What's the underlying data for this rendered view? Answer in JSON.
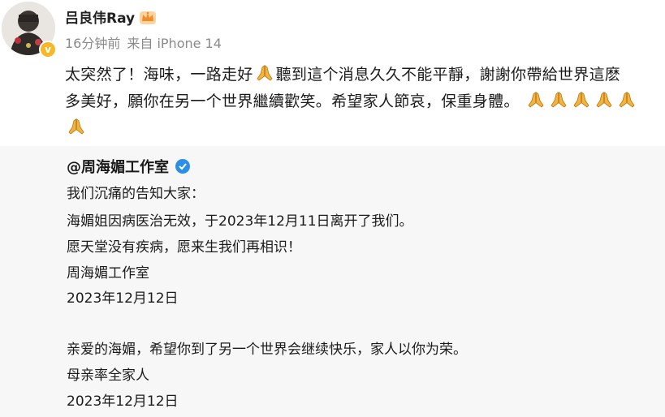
{
  "post": {
    "username": "吕良伟Ray",
    "time": "16分钟前",
    "source": "来自 iPhone 14",
    "text_line1_a": "太突然了！海味，一路走好",
    "text_line1_b": "聽到這个消息久久不能平靜，謝謝你帶給世界這麽",
    "text_line2": "多美好，願你在另一个世界繼續歡笑。希望家人節哀，保重身體。"
  },
  "repost": {
    "author": "@周海媚工作室",
    "lines": [
      "我们沉痛的告知大家：",
      "海媚姐因病医治无效，于2023年12月11日离开了我们。",
      "愿天堂没有疾病，愿来生我们再相识！",
      "周海媚工作室",
      "2023年12月12日",
      "亲爱的海媚，希望你到了另一个世界会继续快乐，家人以你为荣。",
      "母亲率全家人",
      "2023年12月12日"
    ]
  },
  "icons": {
    "verified_gold": "gold-v-badge-icon",
    "verified_blue": "blue-v-badge-icon",
    "crown": "crown-icon",
    "pray": "folded-hands-icon"
  },
  "colors": {
    "meta_gray": "#8a8a8a",
    "verified_gold": "#f6b728",
    "verified_blue": "#2c8ee6",
    "repost_bg": "#f7f7f7"
  }
}
